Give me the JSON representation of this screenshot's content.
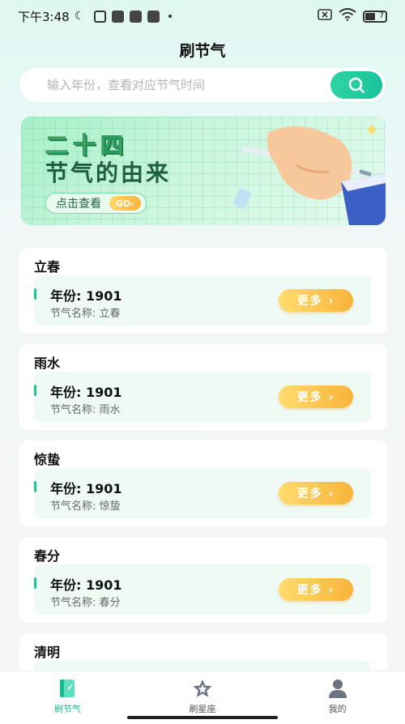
{
  "status_bar": {
    "time": "下午3:48",
    "battery": "7"
  },
  "header": {
    "title": "刷节气"
  },
  "search": {
    "placeholder": "输入年份，查看对应节气时间"
  },
  "banner": {
    "line1": "二十四",
    "line2": "节气的由来",
    "cta": "点击查看",
    "go": "GO›"
  },
  "cards": [
    {
      "term": "立春",
      "year": "年份: 1901",
      "name": "节气名称: 立春",
      "more": "更多 ›"
    },
    {
      "term": "雨水",
      "year": "年份: 1901",
      "name": "节气名称: 雨水",
      "more": "更多 ›"
    },
    {
      "term": "惊蛰",
      "year": "年份: 1901",
      "name": "节气名称: 惊蛰",
      "more": "更多 ›"
    },
    {
      "term": "春分",
      "year": "年份: 1901",
      "name": "节气名称: 春分",
      "more": "更多 ›"
    },
    {
      "term": "清明"
    }
  ],
  "tabs": [
    {
      "label": "刷节气",
      "icon": "book-icon",
      "active": true
    },
    {
      "label": "刷星座",
      "icon": "star-icon",
      "active": false
    },
    {
      "label": "我的",
      "icon": "user-icon",
      "active": false
    }
  ],
  "colors": {
    "accent": "#1bc79a",
    "button": "#f8b43a"
  }
}
